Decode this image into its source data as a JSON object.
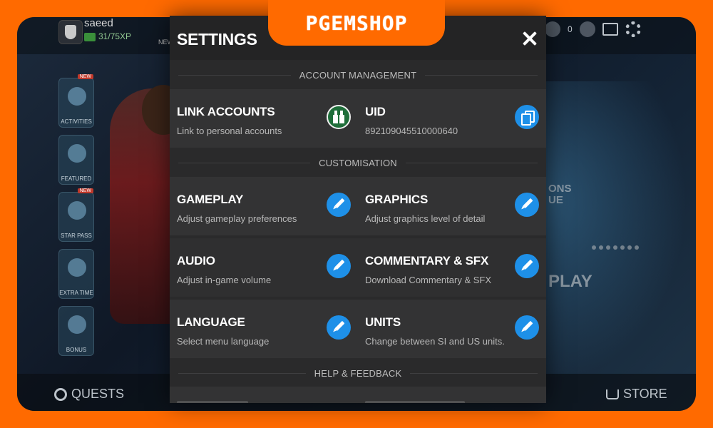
{
  "brand": {
    "logo_text": "PGEMSHOP",
    "accent": "#ff6a00"
  },
  "background": {
    "username": "saeed",
    "xp": "31/75XP",
    "new_label": "NEW",
    "side_tiles": [
      {
        "label": "ACTIVITIES",
        "tag": "NEW"
      },
      {
        "label": "FEATURED",
        "tag": ""
      },
      {
        "label": "STAR PASS",
        "tag": "NEW"
      },
      {
        "label": "EXTRA TIME",
        "tag": ""
      },
      {
        "label": "BONUS",
        "tag": ""
      }
    ],
    "coins": "0",
    "quests_label": "QUESTS",
    "store_label": "STORE",
    "play_label": "PLAY",
    "ons_label": "ONS\nUE"
  },
  "settings": {
    "title": "SETTINGS",
    "sections": {
      "account": "ACCOUNT MANAGEMENT",
      "customisation": "CUSTOMISATION",
      "help": "HELP & FEEDBACK"
    },
    "items": {
      "link_accounts": {
        "title": "LINK ACCOUNTS",
        "sub": "Link to personal accounts",
        "icon": "gift-icon"
      },
      "uid": {
        "title": "UID",
        "sub": "892109045510000640",
        "icon": "copy-icon"
      },
      "gameplay": {
        "title": "GAMEPLAY",
        "sub": "Adjust gameplay preferences",
        "icon": "pencil-icon"
      },
      "graphics": {
        "title": "GRAPHICS",
        "sub": "Adjust graphics level of detail",
        "icon": "pencil-icon"
      },
      "audio": {
        "title": "AUDIO",
        "sub": "Adjust in-game volume",
        "icon": "pencil-icon"
      },
      "commentary": {
        "title": "COMMENTARY & SFX",
        "sub": "Download Commentary & SFX",
        "icon": "pencil-icon"
      },
      "language": {
        "title": "LANGUAGE",
        "sub": "Select menu language",
        "icon": "pencil-icon"
      },
      "units": {
        "title": "UNITS",
        "sub": "Change between SI and US units.",
        "icon": "pencil-icon"
      }
    }
  },
  "colors": {
    "button_blue": "#1e90e8",
    "gift_green": "#1f6e3a",
    "modal_bg": "#2a2a2b"
  }
}
